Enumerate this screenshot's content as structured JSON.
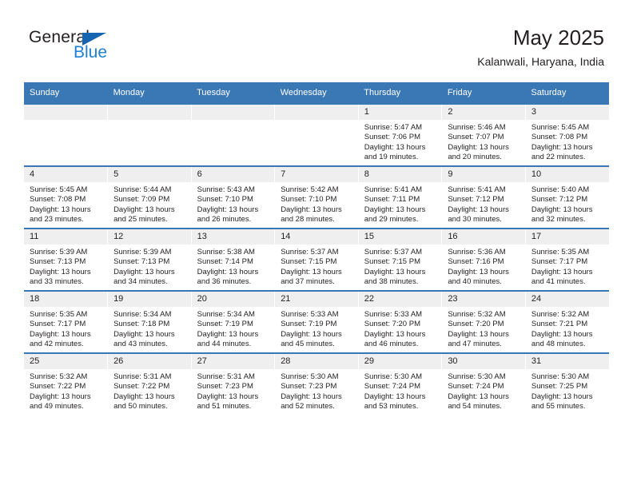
{
  "brand": {
    "name_top": "General",
    "name_bottom": "Blue",
    "triangle_color": "#1565b0",
    "blue_text_color": "#1e7fd4"
  },
  "header": {
    "title": "May 2025",
    "subtitle": "Kalanwali, Haryana, India",
    "header_bg": "#3a77b5",
    "daynum_bg": "#efefef"
  },
  "weekdays": [
    "Sunday",
    "Monday",
    "Tuesday",
    "Wednesday",
    "Thursday",
    "Friday",
    "Saturday"
  ],
  "labels": {
    "sunrise_prefix": "Sunrise: ",
    "sunset_prefix": "Sunset: ",
    "daylight_prefix": "Daylight: "
  },
  "weeks": [
    [
      {
        "day": "",
        "empty": true
      },
      {
        "day": "",
        "empty": true
      },
      {
        "day": "",
        "empty": true
      },
      {
        "day": "",
        "empty": true
      },
      {
        "day": "1",
        "sunrise": "Sunrise: 5:47 AM",
        "sunset": "Sunset: 7:06 PM",
        "daylight_l1": "Daylight: 13 hours",
        "daylight_l2": "and 19 minutes."
      },
      {
        "day": "2",
        "sunrise": "Sunrise: 5:46 AM",
        "sunset": "Sunset: 7:07 PM",
        "daylight_l1": "Daylight: 13 hours",
        "daylight_l2": "and 20 minutes."
      },
      {
        "day": "3",
        "sunrise": "Sunrise: 5:45 AM",
        "sunset": "Sunset: 7:08 PM",
        "daylight_l1": "Daylight: 13 hours",
        "daylight_l2": "and 22 minutes."
      }
    ],
    [
      {
        "day": "4",
        "sunrise": "Sunrise: 5:45 AM",
        "sunset": "Sunset: 7:08 PM",
        "daylight_l1": "Daylight: 13 hours",
        "daylight_l2": "and 23 minutes."
      },
      {
        "day": "5",
        "sunrise": "Sunrise: 5:44 AM",
        "sunset": "Sunset: 7:09 PM",
        "daylight_l1": "Daylight: 13 hours",
        "daylight_l2": "and 25 minutes."
      },
      {
        "day": "6",
        "sunrise": "Sunrise: 5:43 AM",
        "sunset": "Sunset: 7:10 PM",
        "daylight_l1": "Daylight: 13 hours",
        "daylight_l2": "and 26 minutes."
      },
      {
        "day": "7",
        "sunrise": "Sunrise: 5:42 AM",
        "sunset": "Sunset: 7:10 PM",
        "daylight_l1": "Daylight: 13 hours",
        "daylight_l2": "and 28 minutes."
      },
      {
        "day": "8",
        "sunrise": "Sunrise: 5:41 AM",
        "sunset": "Sunset: 7:11 PM",
        "daylight_l1": "Daylight: 13 hours",
        "daylight_l2": "and 29 minutes."
      },
      {
        "day": "9",
        "sunrise": "Sunrise: 5:41 AM",
        "sunset": "Sunset: 7:12 PM",
        "daylight_l1": "Daylight: 13 hours",
        "daylight_l2": "and 30 minutes."
      },
      {
        "day": "10",
        "sunrise": "Sunrise: 5:40 AM",
        "sunset": "Sunset: 7:12 PM",
        "daylight_l1": "Daylight: 13 hours",
        "daylight_l2": "and 32 minutes."
      }
    ],
    [
      {
        "day": "11",
        "sunrise": "Sunrise: 5:39 AM",
        "sunset": "Sunset: 7:13 PM",
        "daylight_l1": "Daylight: 13 hours",
        "daylight_l2": "and 33 minutes."
      },
      {
        "day": "12",
        "sunrise": "Sunrise: 5:39 AM",
        "sunset": "Sunset: 7:13 PM",
        "daylight_l1": "Daylight: 13 hours",
        "daylight_l2": "and 34 minutes."
      },
      {
        "day": "13",
        "sunrise": "Sunrise: 5:38 AM",
        "sunset": "Sunset: 7:14 PM",
        "daylight_l1": "Daylight: 13 hours",
        "daylight_l2": "and 36 minutes."
      },
      {
        "day": "14",
        "sunrise": "Sunrise: 5:37 AM",
        "sunset": "Sunset: 7:15 PM",
        "daylight_l1": "Daylight: 13 hours",
        "daylight_l2": "and 37 minutes."
      },
      {
        "day": "15",
        "sunrise": "Sunrise: 5:37 AM",
        "sunset": "Sunset: 7:15 PM",
        "daylight_l1": "Daylight: 13 hours",
        "daylight_l2": "and 38 minutes."
      },
      {
        "day": "16",
        "sunrise": "Sunrise: 5:36 AM",
        "sunset": "Sunset: 7:16 PM",
        "daylight_l1": "Daylight: 13 hours",
        "daylight_l2": "and 40 minutes."
      },
      {
        "day": "17",
        "sunrise": "Sunrise: 5:35 AM",
        "sunset": "Sunset: 7:17 PM",
        "daylight_l1": "Daylight: 13 hours",
        "daylight_l2": "and 41 minutes."
      }
    ],
    [
      {
        "day": "18",
        "sunrise": "Sunrise: 5:35 AM",
        "sunset": "Sunset: 7:17 PM",
        "daylight_l1": "Daylight: 13 hours",
        "daylight_l2": "and 42 minutes."
      },
      {
        "day": "19",
        "sunrise": "Sunrise: 5:34 AM",
        "sunset": "Sunset: 7:18 PM",
        "daylight_l1": "Daylight: 13 hours",
        "daylight_l2": "and 43 minutes."
      },
      {
        "day": "20",
        "sunrise": "Sunrise: 5:34 AM",
        "sunset": "Sunset: 7:19 PM",
        "daylight_l1": "Daylight: 13 hours",
        "daylight_l2": "and 44 minutes."
      },
      {
        "day": "21",
        "sunrise": "Sunrise: 5:33 AM",
        "sunset": "Sunset: 7:19 PM",
        "daylight_l1": "Daylight: 13 hours",
        "daylight_l2": "and 45 minutes."
      },
      {
        "day": "22",
        "sunrise": "Sunrise: 5:33 AM",
        "sunset": "Sunset: 7:20 PM",
        "daylight_l1": "Daylight: 13 hours",
        "daylight_l2": "and 46 minutes."
      },
      {
        "day": "23",
        "sunrise": "Sunrise: 5:32 AM",
        "sunset": "Sunset: 7:20 PM",
        "daylight_l1": "Daylight: 13 hours",
        "daylight_l2": "and 47 minutes."
      },
      {
        "day": "24",
        "sunrise": "Sunrise: 5:32 AM",
        "sunset": "Sunset: 7:21 PM",
        "daylight_l1": "Daylight: 13 hours",
        "daylight_l2": "and 48 minutes."
      }
    ],
    [
      {
        "day": "25",
        "sunrise": "Sunrise: 5:32 AM",
        "sunset": "Sunset: 7:22 PM",
        "daylight_l1": "Daylight: 13 hours",
        "daylight_l2": "and 49 minutes."
      },
      {
        "day": "26",
        "sunrise": "Sunrise: 5:31 AM",
        "sunset": "Sunset: 7:22 PM",
        "daylight_l1": "Daylight: 13 hours",
        "daylight_l2": "and 50 minutes."
      },
      {
        "day": "27",
        "sunrise": "Sunrise: 5:31 AM",
        "sunset": "Sunset: 7:23 PM",
        "daylight_l1": "Daylight: 13 hours",
        "daylight_l2": "and 51 minutes."
      },
      {
        "day": "28",
        "sunrise": "Sunrise: 5:30 AM",
        "sunset": "Sunset: 7:23 PM",
        "daylight_l1": "Daylight: 13 hours",
        "daylight_l2": "and 52 minutes."
      },
      {
        "day": "29",
        "sunrise": "Sunrise: 5:30 AM",
        "sunset": "Sunset: 7:24 PM",
        "daylight_l1": "Daylight: 13 hours",
        "daylight_l2": "and 53 minutes."
      },
      {
        "day": "30",
        "sunrise": "Sunrise: 5:30 AM",
        "sunset": "Sunset: 7:24 PM",
        "daylight_l1": "Daylight: 13 hours",
        "daylight_l2": "and 54 minutes."
      },
      {
        "day": "31",
        "sunrise": "Sunrise: 5:30 AM",
        "sunset": "Sunset: 7:25 PM",
        "daylight_l1": "Daylight: 13 hours",
        "daylight_l2": "and 55 minutes."
      }
    ]
  ]
}
